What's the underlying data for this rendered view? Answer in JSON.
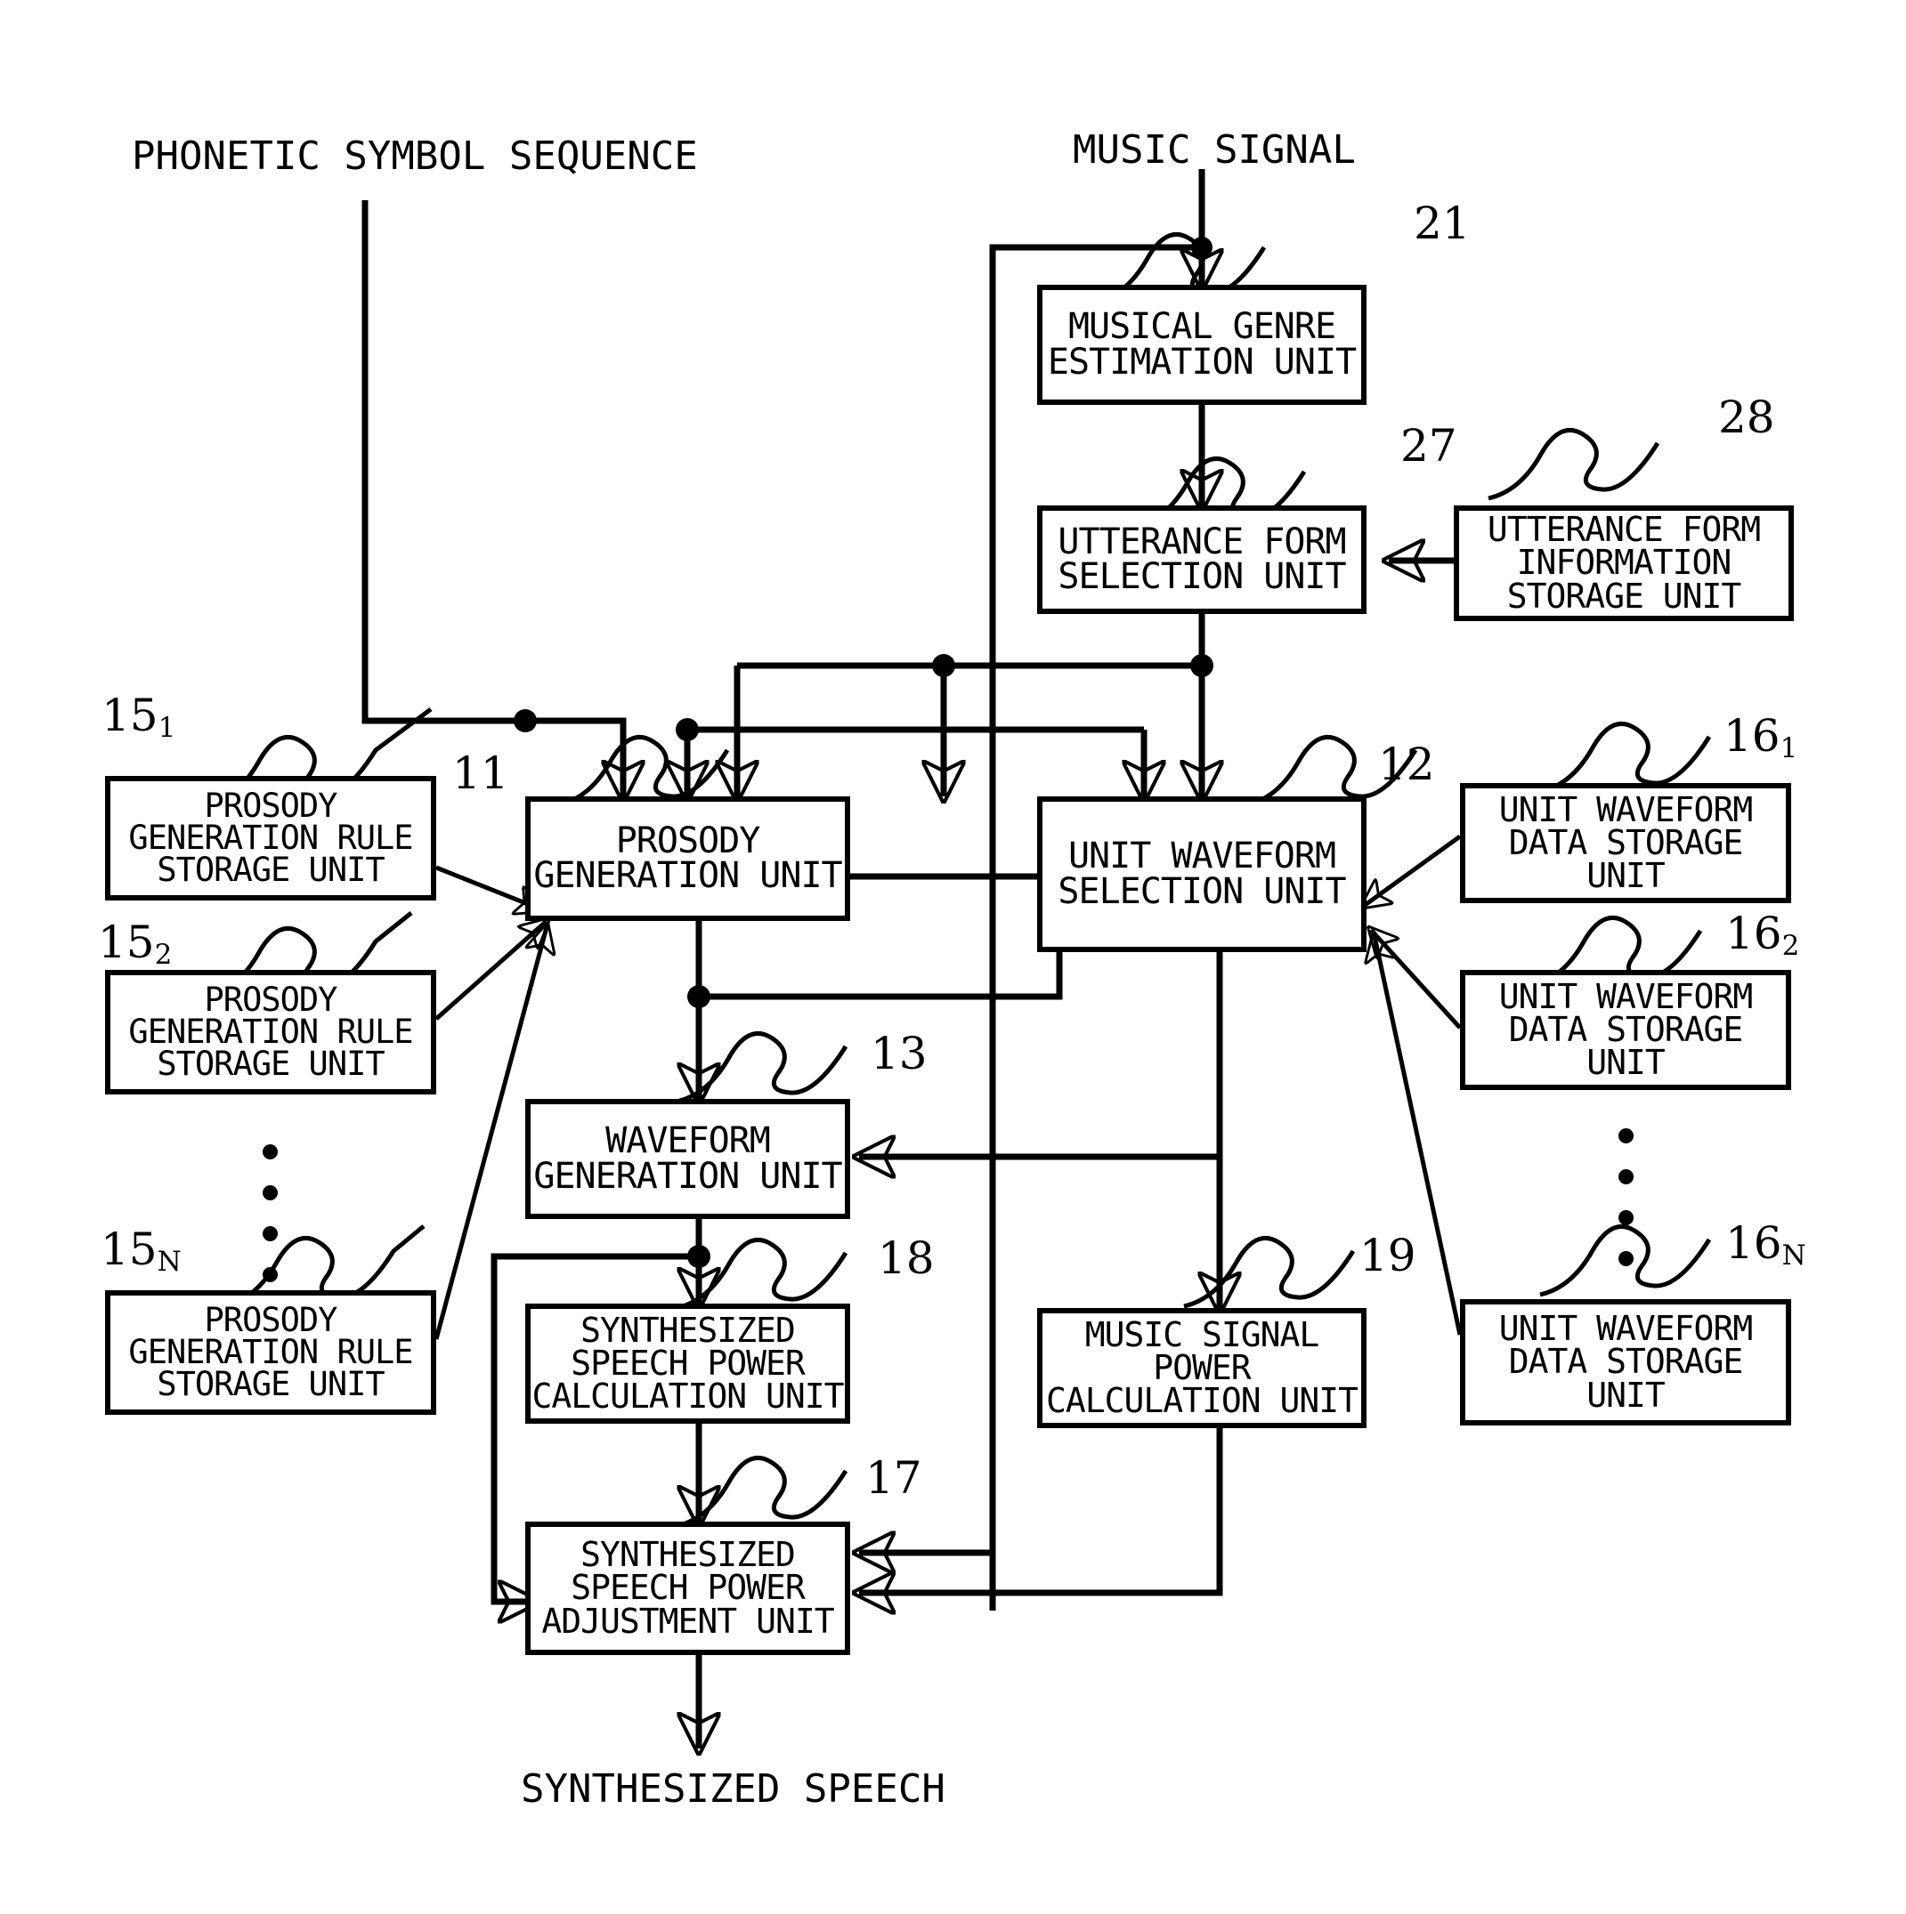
{
  "figure": {
    "type": "block-diagram",
    "domain": "patent-figure",
    "line_color": "#000000",
    "background": "#ffffff"
  },
  "io_labels": {
    "input_phonetic": "PHONETIC SYMBOL SEQUENCE",
    "input_music": "MUSIC SIGNAL",
    "output_speech": "SYNTHESIZED SPEECH"
  },
  "blocks": [
    {
      "id": "b21",
      "ref": "21",
      "ref_sub": "",
      "lines": [
        "MUSICAL GENRE",
        "ESTIMATION UNIT"
      ]
    },
    {
      "id": "b27",
      "ref": "27",
      "ref_sub": "",
      "lines": [
        "UTTERANCE FORM",
        "SELECTION UNIT"
      ]
    },
    {
      "id": "b28",
      "ref": "28",
      "ref_sub": "",
      "lines": [
        "UTTERANCE FORM",
        "INFORMATION",
        "STORAGE UNIT"
      ]
    },
    {
      "id": "b151",
      "ref": "15",
      "ref_sub": "1",
      "lines": [
        "PROSODY",
        "GENERATION RULE",
        "STORAGE UNIT"
      ]
    },
    {
      "id": "b152",
      "ref": "15",
      "ref_sub": "2",
      "lines": [
        "PROSODY",
        "GENERATION RULE",
        "STORAGE UNIT"
      ]
    },
    {
      "id": "b15n",
      "ref": "15",
      "ref_sub": "N",
      "lines": [
        "PROSODY",
        "GENERATION RULE",
        "STORAGE UNIT"
      ]
    },
    {
      "id": "b11",
      "ref": "11",
      "ref_sub": "",
      "lines": [
        "PROSODY",
        "GENERATION UNIT"
      ]
    },
    {
      "id": "b12",
      "ref": "12",
      "ref_sub": "",
      "lines": [
        "UNIT WAVEFORM",
        "SELECTION UNIT"
      ]
    },
    {
      "id": "b161",
      "ref": "16",
      "ref_sub": "1",
      "lines": [
        "UNIT WAVEFORM",
        "DATA STORAGE",
        "UNIT"
      ]
    },
    {
      "id": "b162",
      "ref": "16",
      "ref_sub": "2",
      "lines": [
        "UNIT WAVEFORM",
        "DATA STORAGE",
        "UNIT"
      ]
    },
    {
      "id": "b16n",
      "ref": "16",
      "ref_sub": "N",
      "lines": [
        "UNIT WAVEFORM",
        "DATA STORAGE",
        "UNIT"
      ]
    },
    {
      "id": "b13",
      "ref": "13",
      "ref_sub": "",
      "lines": [
        "WAVEFORM",
        "GENERATION UNIT"
      ]
    },
    {
      "id": "b18",
      "ref": "18",
      "ref_sub": "",
      "lines": [
        "SYNTHESIZED",
        "SPEECH POWER",
        "CALCULATION UNIT"
      ]
    },
    {
      "id": "b19",
      "ref": "19",
      "ref_sub": "",
      "lines": [
        "MUSIC SIGNAL",
        "POWER",
        "CALCULATION UNIT"
      ]
    },
    {
      "id": "b17",
      "ref": "17",
      "ref_sub": "",
      "lines": [
        "SYNTHESIZED",
        "SPEECH POWER",
        "ADJUSTMENT UNIT"
      ]
    }
  ],
  "reference_numerals": [
    "21",
    "27",
    "28",
    "15₁",
    "15₂",
    "15ₙ",
    "11",
    "12",
    "16₁",
    "16₂",
    "16ₙ",
    "13",
    "18",
    "19",
    "17"
  ]
}
